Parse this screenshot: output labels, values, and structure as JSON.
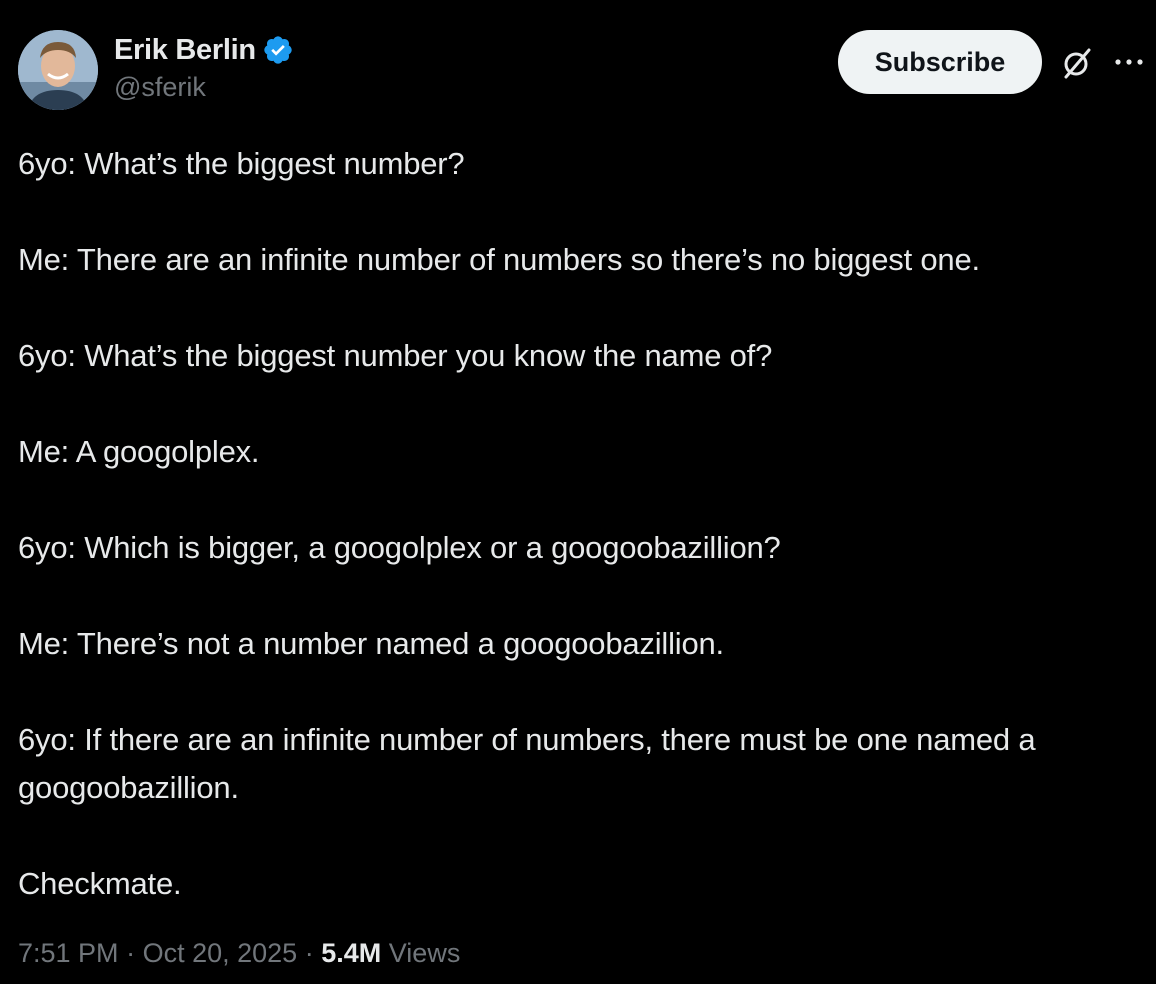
{
  "author": {
    "display_name": "Erik Berlin",
    "handle": "@sferik",
    "verified": true,
    "verified_color": "#1d9bf0"
  },
  "actions": {
    "subscribe_label": "Subscribe",
    "grok_icon": "grok-icon",
    "more_icon": "more-icon"
  },
  "post": {
    "paragraphs": [
      "6yo: What’s the biggest number?",
      "Me: There are an infinite number of numbers so there’s no biggest one.",
      "6yo: What’s the biggest number you know the name of?",
      "Me: A googolplex.",
      "6yo: Which is bigger, a googolplex or a googoobazillion?",
      "Me: There’s not a number named a googoobazillion.",
      "6yo: If there are an infinite number of numbers, there must be one named a googoobazillion.",
      "Checkmate."
    ]
  },
  "meta": {
    "time": "7:51 PM",
    "separator": "·",
    "date": "Oct 20, 2025",
    "views_count": "5.4M",
    "views_label": "Views"
  },
  "colors": {
    "background": "#000000",
    "text": "#e7e9ea",
    "secondary_text": "#71767b",
    "button_bg": "#eff3f4",
    "button_text": "#0f1419"
  }
}
